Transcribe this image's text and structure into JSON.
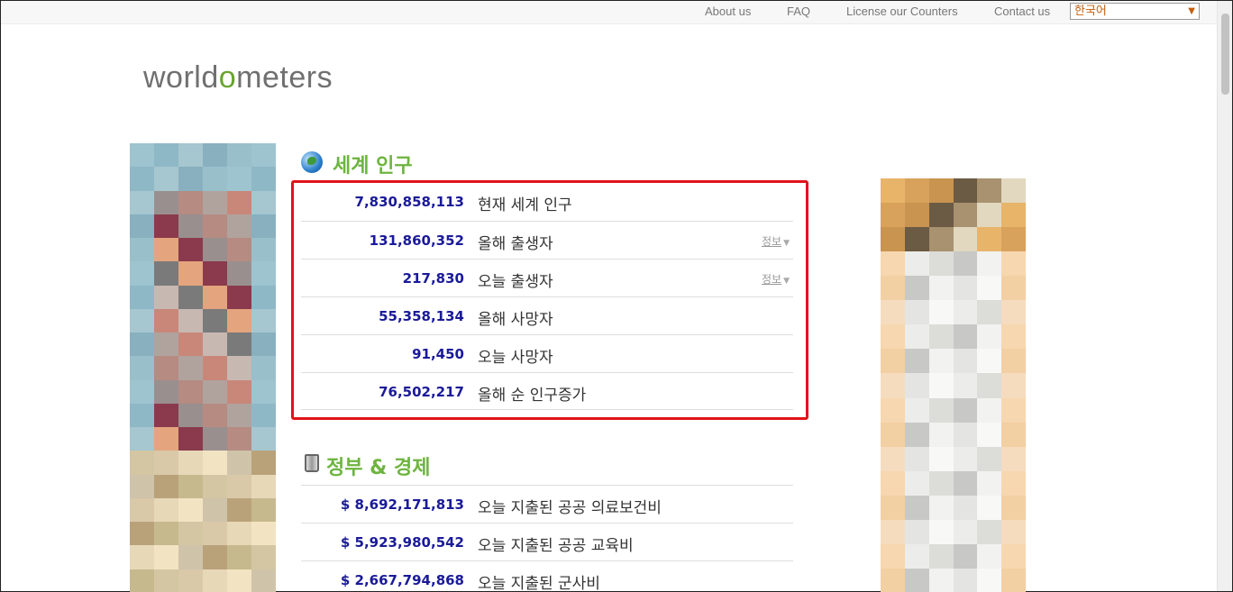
{
  "topnav": {
    "about": "About us",
    "faq": "FAQ",
    "license": "License our Counters",
    "contact": "Contact us",
    "language": "한국어"
  },
  "logo": {
    "before": "world",
    "o": "o",
    "after": "meters"
  },
  "population": {
    "title": "세계 인구",
    "rows": [
      {
        "value": "7,830,858,113",
        "label": "현재 세계 인구",
        "info": ""
      },
      {
        "value": "131,860,352",
        "label": "올해 출생자",
        "info": "정보"
      },
      {
        "value": "217,830",
        "label": "오늘 출생자",
        "info": "정보"
      },
      {
        "value": "55,358,134",
        "label": "올해 사망자",
        "info": ""
      },
      {
        "value": "91,450",
        "label": "오늘 사망자",
        "info": ""
      },
      {
        "value": "76,502,217",
        "label": "올해 순 인구증가",
        "info": ""
      }
    ]
  },
  "government": {
    "title": "정부 & 경제",
    "rows": [
      {
        "value": "$ 8,692,171,813",
        "label": "오늘 지출된 공공 의료보건비"
      },
      {
        "value": "$ 5,923,980,542",
        "label": "오늘 지출된 공공 교육비"
      },
      {
        "value": "$ 2,667,794,868",
        "label": "오늘 지출된 군사비"
      }
    ]
  },
  "colors": {
    "accent_green": "#6eb43f",
    "number_blue": "#1a1a99",
    "highlight_red": "#e0141b"
  }
}
